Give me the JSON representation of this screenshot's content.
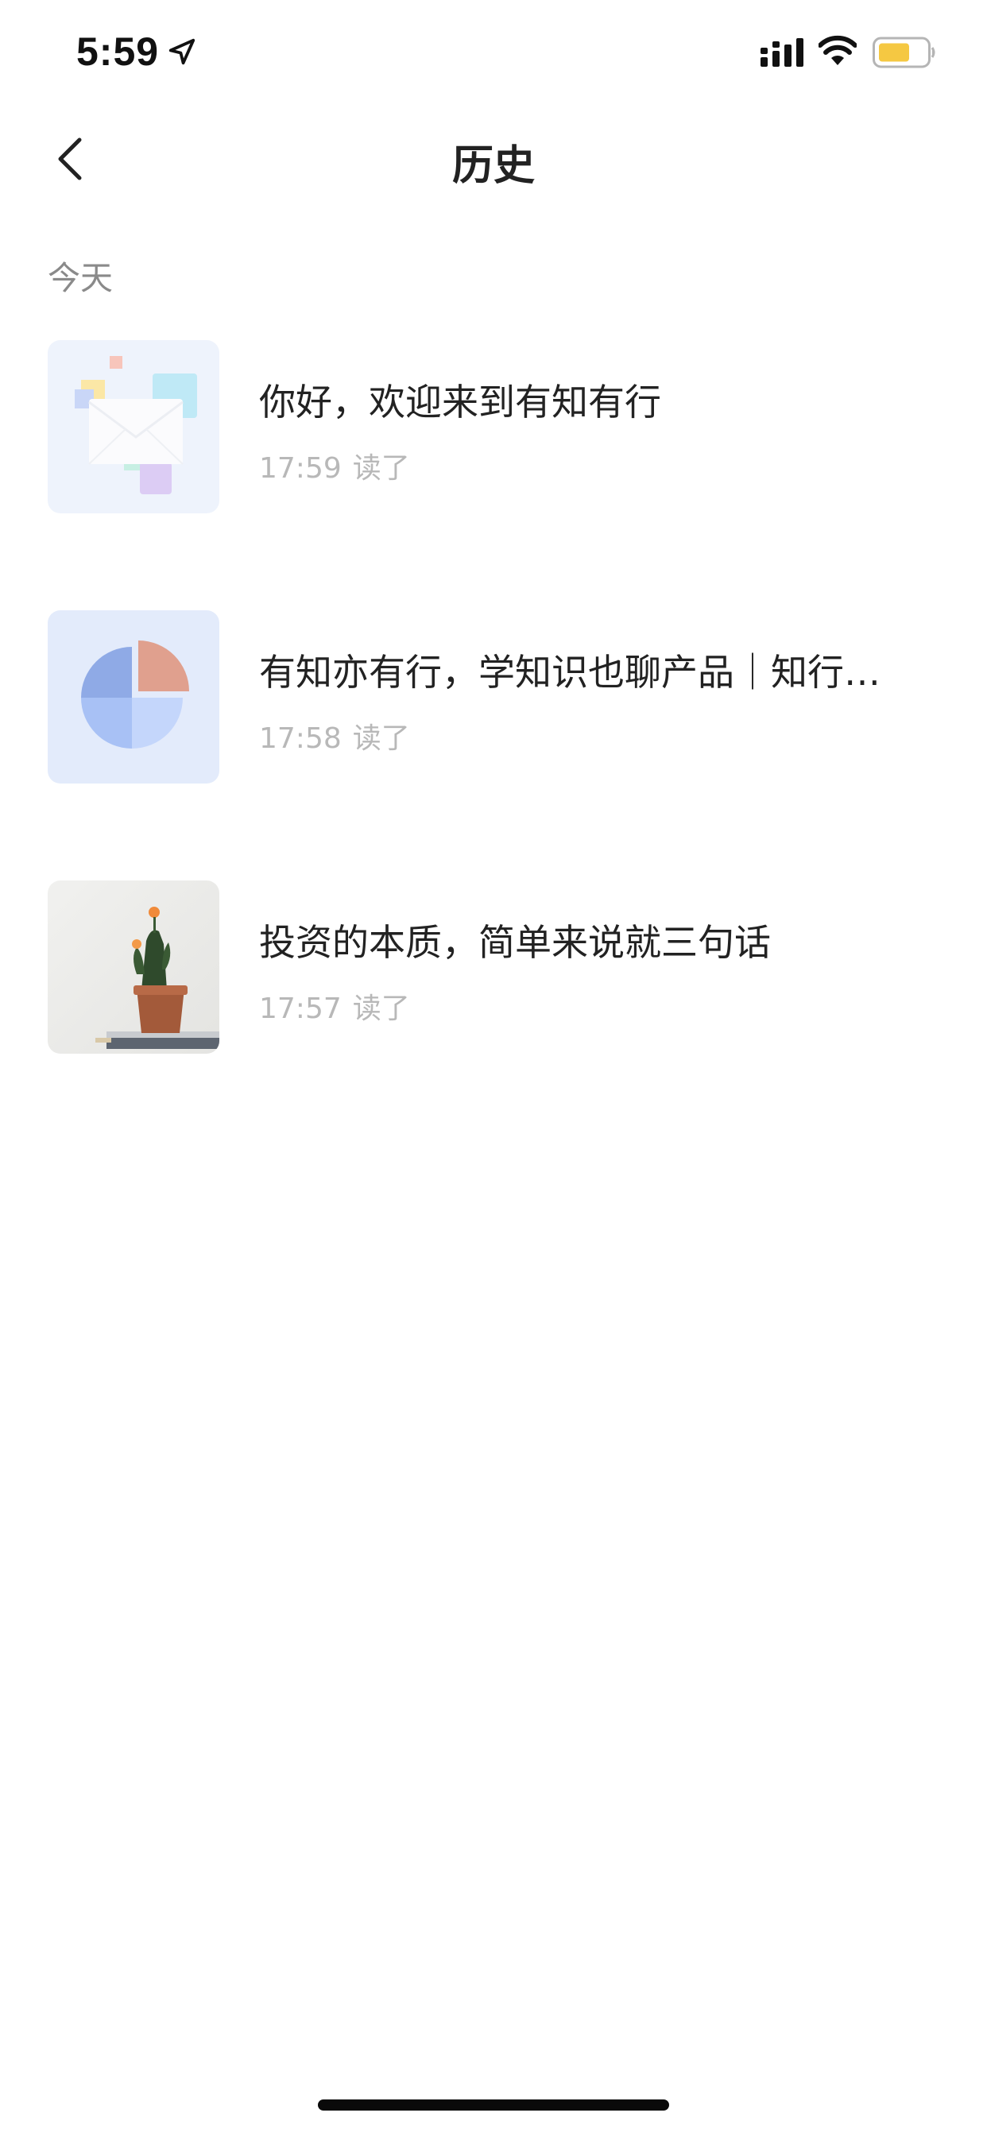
{
  "status_bar": {
    "time": "5:59",
    "icons": [
      "location-arrow-icon",
      "signal-icon",
      "wifi-icon",
      "battery-icon"
    ],
    "battery_color": "#f5c842"
  },
  "nav": {
    "title": "历史",
    "back_icon": "chevron-left-icon"
  },
  "section": {
    "label": "今天"
  },
  "history_items": [
    {
      "title": "你好，欢迎来到有知有行",
      "time": "17:59",
      "status": "读了",
      "thumb": "envelope-illustration"
    },
    {
      "title": "有知亦有行，学知识也聊产品｜知行小酒馆",
      "time": "17:58",
      "status": "读了",
      "thumb": "pie-chart-illustration"
    },
    {
      "title": "投资的本质，简单来说就三句话",
      "time": "17:57",
      "status": "读了",
      "thumb": "cactus-photo"
    }
  ],
  "colors": {
    "title_text": "#222222",
    "meta_text": "#b8b8b8",
    "section_text": "#8a8a8a"
  }
}
